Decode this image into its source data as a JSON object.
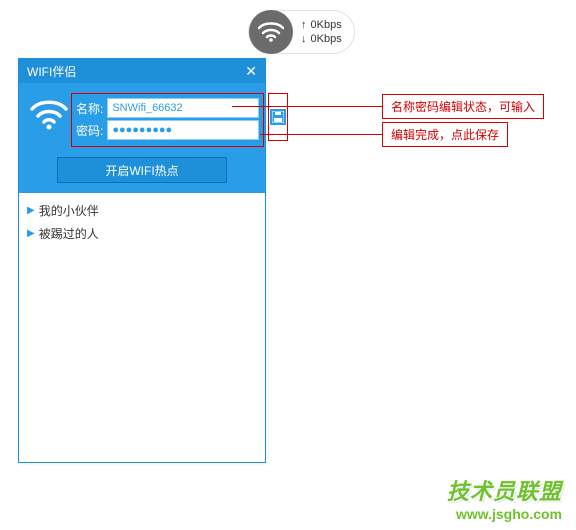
{
  "speed": {
    "up": "0Kbps",
    "down": "0Kbps"
  },
  "window": {
    "title": "WIFI伴侣",
    "name_label": "名称:",
    "name_value": "SNWifi_66632",
    "password_label": "密码:",
    "password_value": "●●●●●●●●●",
    "start_button": "开启WIFI热点"
  },
  "list": {
    "item1": "我的小伙伴",
    "item2": "被踢过的人"
  },
  "callouts": {
    "c1": "名称密码编辑状态，可输入",
    "c2": "编辑完成，点此保存"
  },
  "watermark": {
    "title": "技术员联盟",
    "url": "www.jsgho.com"
  }
}
